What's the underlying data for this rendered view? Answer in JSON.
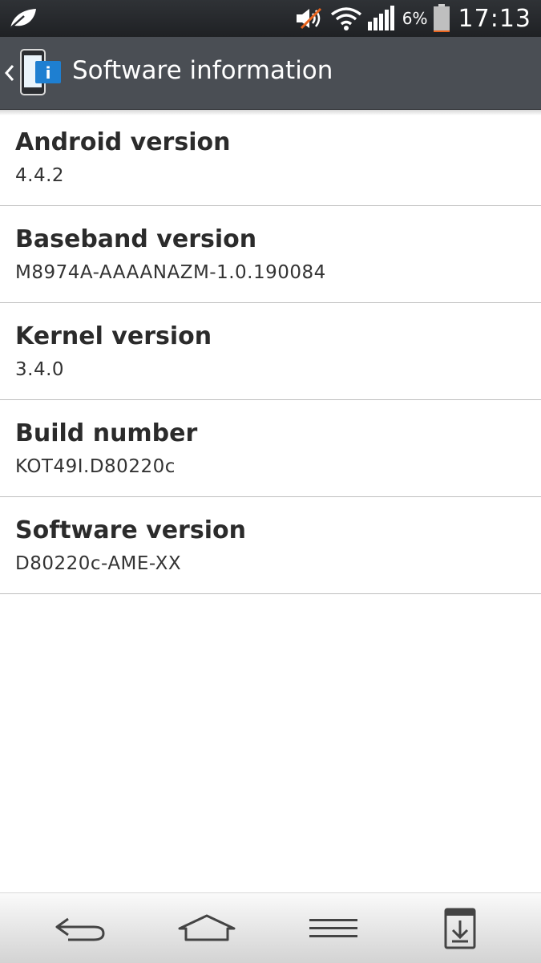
{
  "status_bar": {
    "battery_percent": "6%",
    "time": "17:13",
    "icons": [
      "leaf-notification-icon",
      "volume-muted-icon",
      "wifi-icon",
      "signal-icon",
      "battery-icon"
    ],
    "battery_level": 0.06,
    "battery_fill_color": "#e8641e"
  },
  "action_bar": {
    "title": "Software information",
    "background_color": "#4a4e54",
    "icons": [
      "back-chevron-icon",
      "software-info-icon"
    ]
  },
  "items": [
    {
      "title": "Android version",
      "value": "4.4.2"
    },
    {
      "title": "Baseband version",
      "value": "M8974A-AAAANAZM-1.0.190084"
    },
    {
      "title": "Kernel version",
      "value": "3.4.0"
    },
    {
      "title": "Build number",
      "value": "KOT49I.D80220c"
    },
    {
      "title": "Software version",
      "value": "D80220c-AME-XX"
    }
  ],
  "nav_bar": {
    "icons": [
      "back-icon",
      "home-icon",
      "menu-icon",
      "capture-icon"
    ]
  }
}
